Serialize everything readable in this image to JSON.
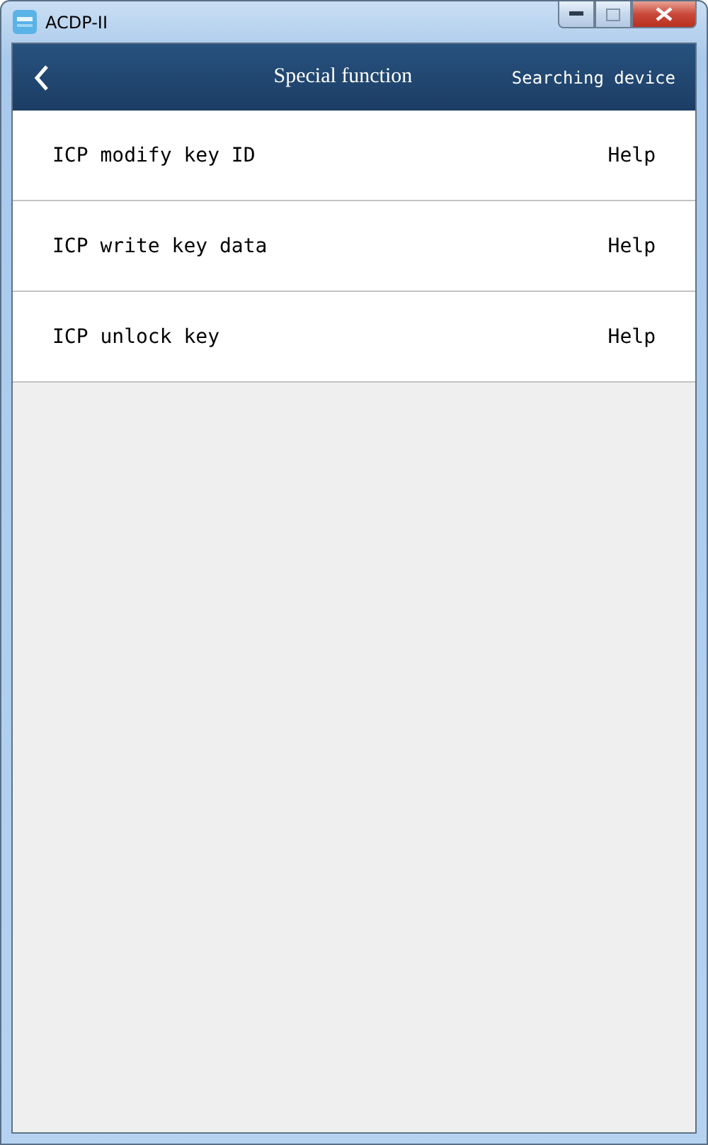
{
  "window": {
    "title": "ACDP-II"
  },
  "header": {
    "title": "Special function",
    "status": "Searching device"
  },
  "functions": [
    {
      "label": "ICP modify key ID",
      "help": "Help"
    },
    {
      "label": "ICP write key data",
      "help": "Help"
    },
    {
      "label": "ICP unlock key",
      "help": "Help"
    }
  ]
}
